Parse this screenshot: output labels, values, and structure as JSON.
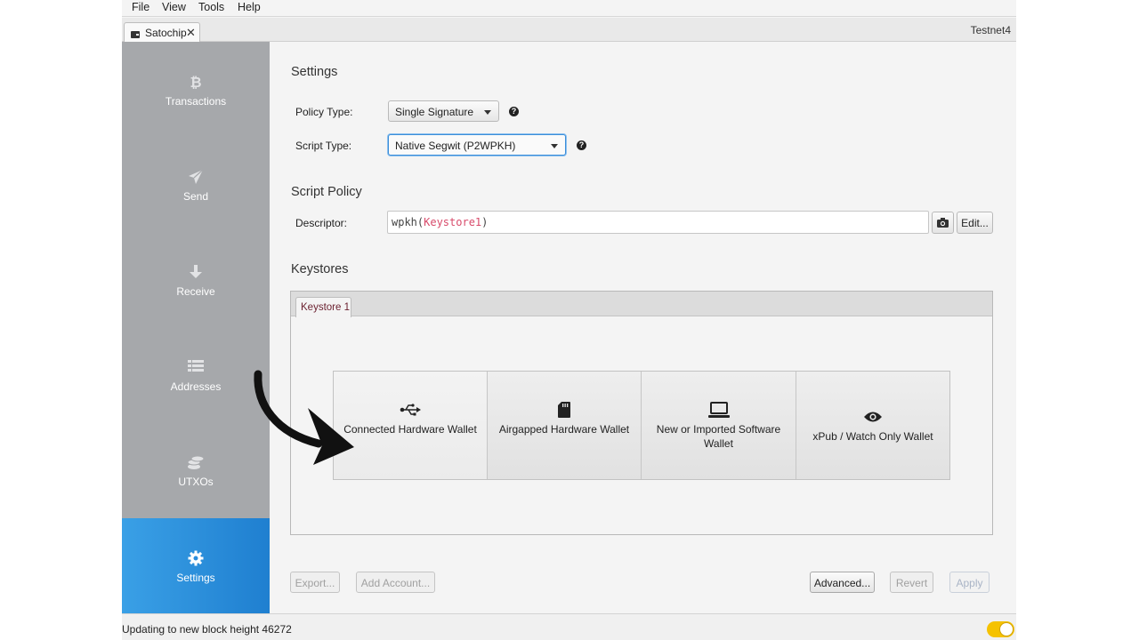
{
  "menu": {
    "items": [
      "File",
      "View",
      "Tools",
      "Help"
    ]
  },
  "tabs": {
    "wallet_tab": {
      "label": "Satochip",
      "close": "✕"
    },
    "network": "Testnet4"
  },
  "sidebar": {
    "items": [
      {
        "label": "Transactions",
        "icon": "bitcoin-icon"
      },
      {
        "label": "Send",
        "icon": "send-icon"
      },
      {
        "label": "Receive",
        "icon": "arrow-down-icon"
      },
      {
        "label": "Addresses",
        "icon": "list-icon"
      },
      {
        "label": "UTXOs",
        "icon": "coins-icon"
      },
      {
        "label": "Settings",
        "icon": "gear-icon",
        "active": true
      }
    ]
  },
  "settings": {
    "title": "Settings",
    "policy_type": {
      "label": "Policy Type:",
      "value": "Single Signature"
    },
    "script_type": {
      "label": "Script Type:",
      "value": "Native Segwit (P2WPKH)"
    },
    "help": "?"
  },
  "script_policy": {
    "title": "Script Policy",
    "descriptor_label": "Descriptor:",
    "descriptor_prefix": "wpkh(",
    "descriptor_keystore": "Keystore1",
    "descriptor_suffix": ")",
    "edit_label": "Edit..."
  },
  "keystores": {
    "title": "Keystores",
    "tab_label": "Keystore 1",
    "options": [
      {
        "label": "Connected Hardware Wallet",
        "icon": "usb-icon"
      },
      {
        "label": "Airgapped Hardware Wallet",
        "icon": "sd-card-icon"
      },
      {
        "label": "New or Imported Software Wallet",
        "icon": "laptop-icon"
      },
      {
        "label": "xPub / Watch Only Wallet",
        "icon": "eye-icon"
      }
    ]
  },
  "footer": {
    "export": "Export...",
    "add_account": "Add Account...",
    "advanced": "Advanced...",
    "revert": "Revert",
    "apply": "Apply"
  },
  "status": {
    "text": "Updating to new block height 46272"
  },
  "colors": {
    "sidebar": "#a6a8ab",
    "active_nav": "#2a8ddd",
    "toggle": "#f5c200",
    "descriptor_keyword": "#d84b6b"
  }
}
